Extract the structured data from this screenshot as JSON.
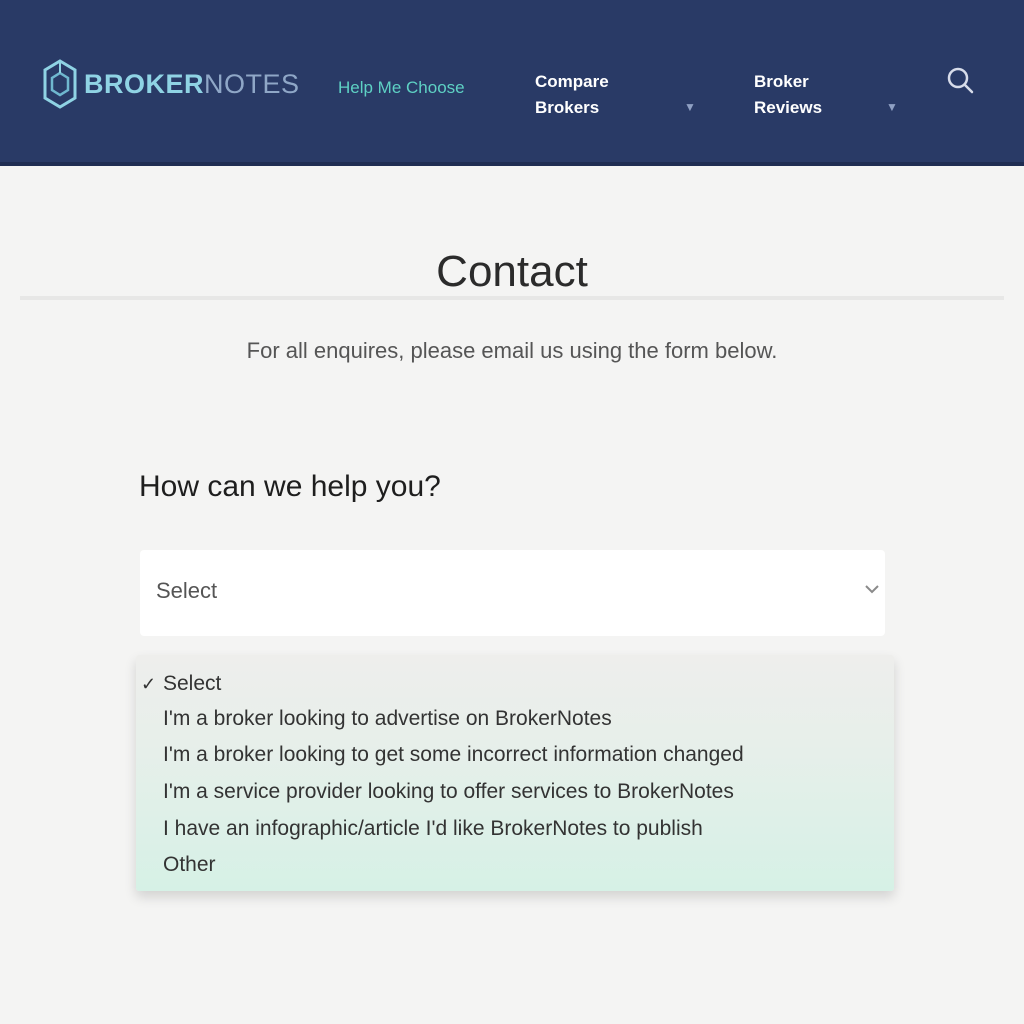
{
  "header": {
    "logo": {
      "part1": "BROKER",
      "part2": "NOTES"
    },
    "nav": {
      "help": "Help Me Choose",
      "compare": "Compare Brokers",
      "reviews": "Broker Reviews"
    },
    "icons": {
      "search": "search-icon",
      "compare_chevron": "chevron-down-icon",
      "reviews_chevron": "chevron-down-icon"
    }
  },
  "page": {
    "title": "Contact",
    "intro": "For all enquires, please email us using the form below.",
    "question": "How can we help you?"
  },
  "select": {
    "value": "Select",
    "check_mark": "✓",
    "options": [
      "Select",
      "I'm a broker looking to advertise on BrokerNotes",
      "I'm a broker looking to get some incorrect information changed",
      "I'm a service provider looking to offer services to BrokerNotes",
      "I have an infographic/article I'd like BrokerNotes to publish",
      "Other"
    ]
  },
  "colors": {
    "nav_background": "#293a66",
    "accent": "#5ed1c4",
    "dropdown_highlight": "#d6f1e6"
  }
}
